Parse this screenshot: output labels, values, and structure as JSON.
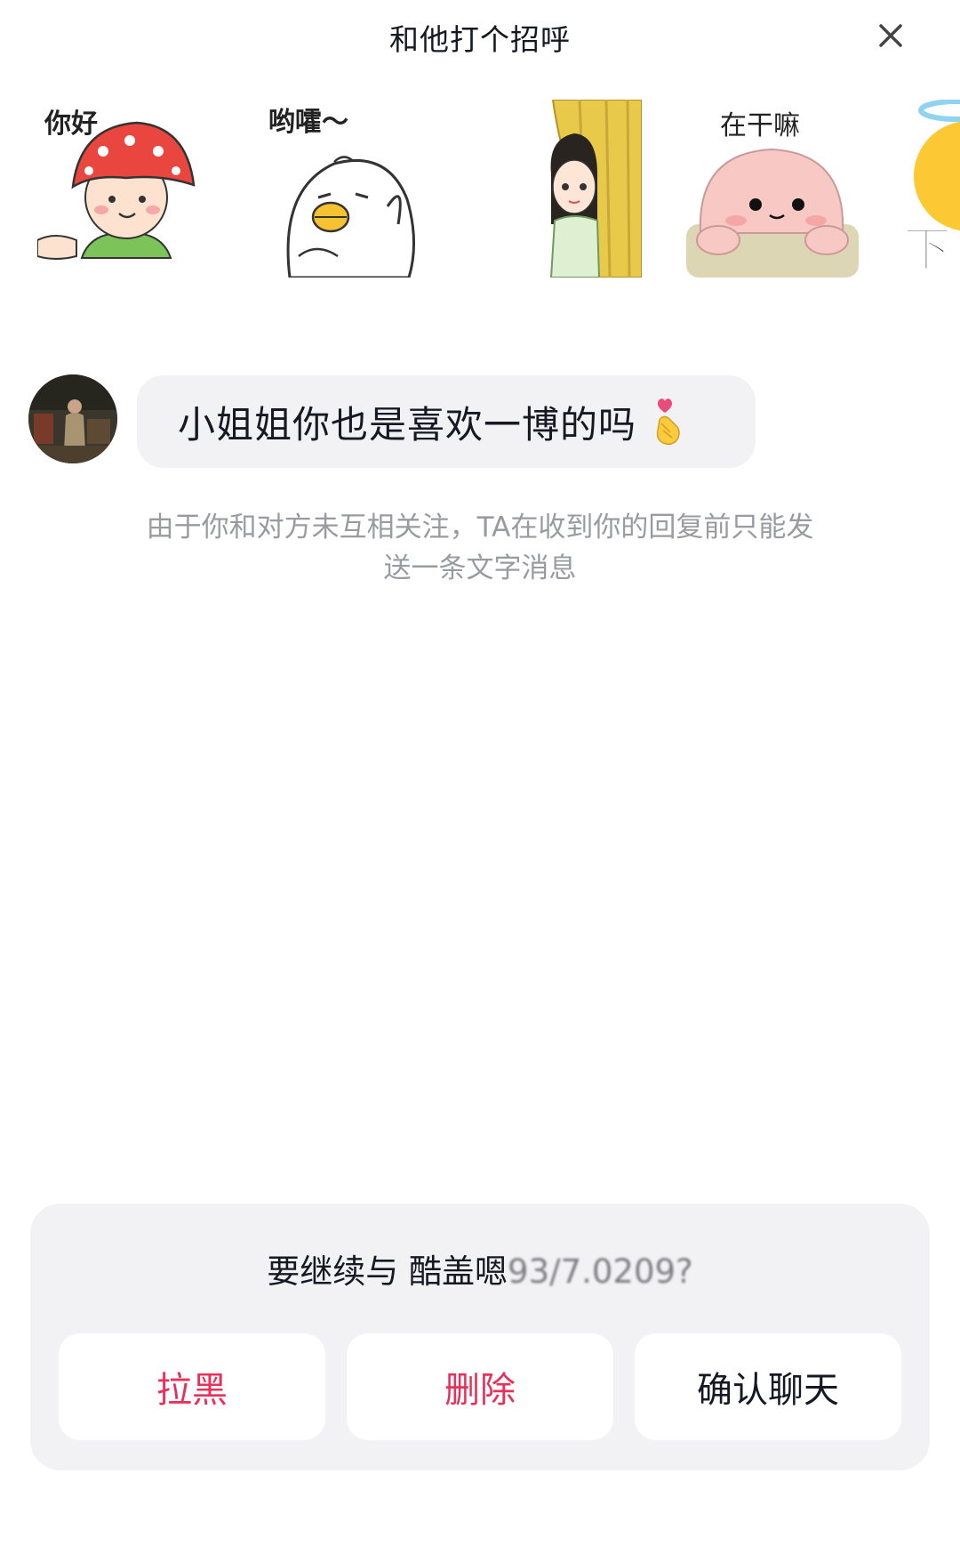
{
  "header": {
    "title": "和他打个招呼",
    "close_icon": "close-icon"
  },
  "stickers": [
    {
      "caption": "你好",
      "icon": "strawberry-girl-sticker"
    },
    {
      "caption": "哟嚯～",
      "icon": "white-duck-sticker"
    },
    {
      "caption": "",
      "icon": "peeking-girl-sticker"
    },
    {
      "caption": "在干嘛",
      "icon": "pink-blob-sticker"
    },
    {
      "caption": "下",
      "icon": "angel-emoji-sticker"
    }
  ],
  "message": {
    "text": "小姐姐你也是喜欢一博的吗",
    "emoji": "finger-heart-emoji"
  },
  "notice": {
    "line1": "由于你和对方未互相关注，TA在收到你的回复前只能发",
    "line2": "送一条文字消息"
  },
  "panel": {
    "prompt": "要继续与 酷盖嗯",
    "obscured_name": "93/7.0209?",
    "buttons": {
      "block": "拉黑",
      "delete": "删除",
      "confirm": "确认聊天"
    }
  },
  "colors": {
    "danger": "#e8305a",
    "text": "#161823",
    "muted": "#9a9ba1",
    "panel_bg": "#f2f2f4"
  }
}
